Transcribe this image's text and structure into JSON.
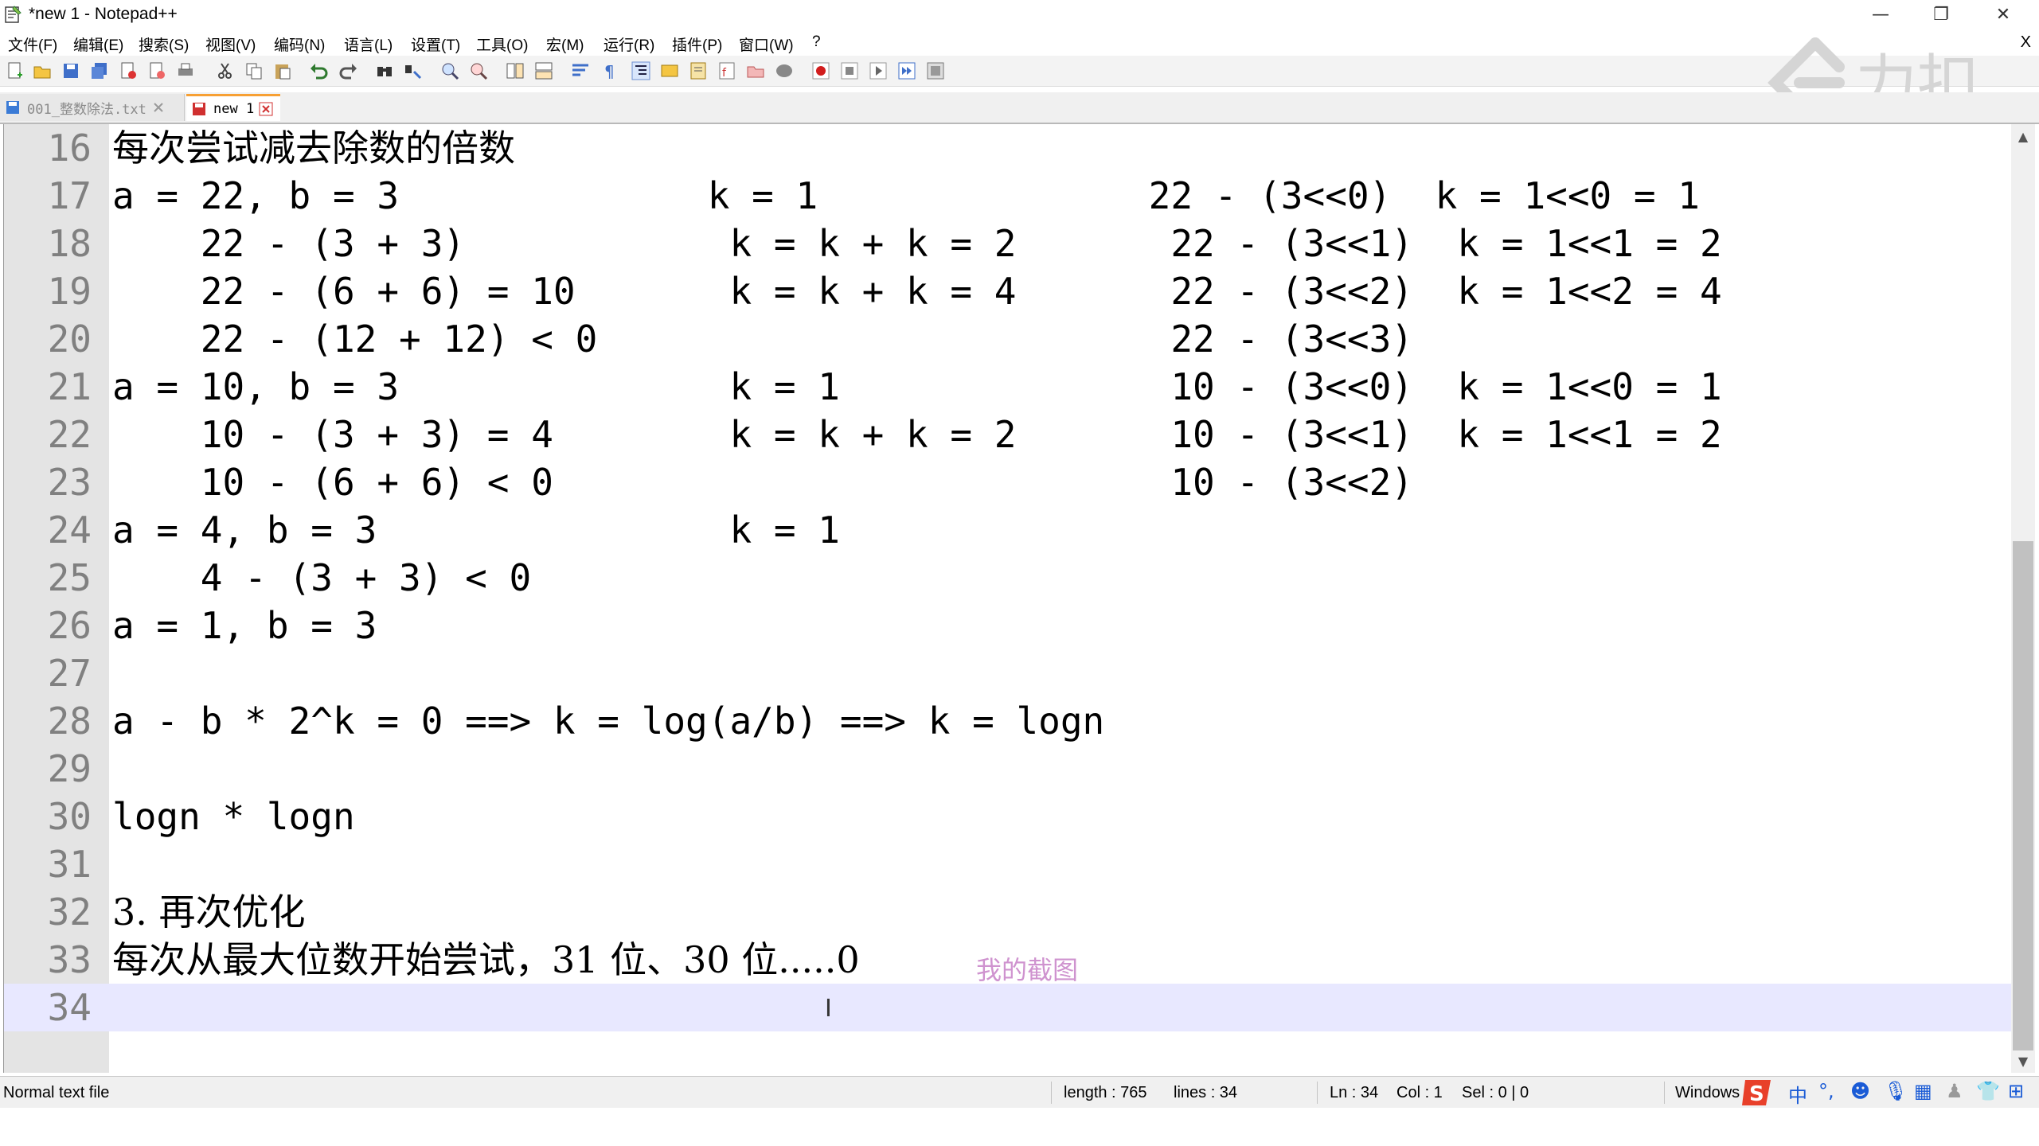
{
  "window": {
    "title": "*new 1 - Notepad++",
    "minimize": "—",
    "restore": "❐",
    "close": "✕"
  },
  "menu": {
    "items": [
      "文件(F)",
      "编辑(E)",
      "搜索(S)",
      "视图(V)",
      "编码(N)",
      "语言(L)",
      "设置(T)",
      "工具(O)",
      "宏(M)",
      "运行(R)",
      "插件(P)",
      "窗口(W)",
      "?"
    ],
    "close_doc": "X"
  },
  "toolbar": {
    "icons": [
      "new-file-icon",
      "open-file-icon",
      "save-icon",
      "save-all-icon",
      "close-icon",
      "close-all-icon",
      "print-icon",
      "cut-icon",
      "copy-icon",
      "paste-icon",
      "undo-icon",
      "redo-icon",
      "find-icon",
      "replace-icon",
      "zoom-in-icon",
      "zoom-out-icon",
      "sync-v-icon",
      "sync-h-icon",
      "word-wrap-icon",
      "show-all-chars-icon",
      "indent-guide-icon",
      "udl-icon",
      "doc-map-icon",
      "function-list-icon",
      "folder-workspace-icon",
      "monitor-icon",
      "record-macro-icon",
      "stop-record-icon",
      "play-macro-icon",
      "run-macro-multiple-icon",
      "save-macro-icon"
    ]
  },
  "watermark": {
    "text": "力扣"
  },
  "tabs": [
    {
      "label": "001_整数除法.txt",
      "active": false,
      "color": "#3b7bd6"
    },
    {
      "label": "new 1",
      "active": true,
      "color": "#d03030"
    }
  ],
  "editor": {
    "lines": [
      {
        "num": "16",
        "text": "每次尝试减去除数的倍数"
      },
      {
        "num": "17",
        "text": "a = 22, b = 3              k = 1               22 - (3<<0)  k = 1<<0 = 1"
      },
      {
        "num": "18",
        "text": "    22 - (3 + 3)            k = k + k = 2       22 - (3<<1)  k = 1<<1 = 2"
      },
      {
        "num": "19",
        "text": "    22 - (6 + 6) = 10       k = k + k = 4       22 - (3<<2)  k = 1<<2 = 4"
      },
      {
        "num": "20",
        "text": "    22 - (12 + 12) < 0                          22 - (3<<3)"
      },
      {
        "num": "21",
        "text": "a = 10, b = 3               k = 1               10 - (3<<0)  k = 1<<0 = 1"
      },
      {
        "num": "22",
        "text": "    10 - (3 + 3) = 4        k = k + k = 2       10 - (3<<1)  k = 1<<1 = 2"
      },
      {
        "num": "23",
        "text": "    10 - (6 + 6) < 0                            10 - (3<<2)"
      },
      {
        "num": "24",
        "text": "a = 4, b = 3                k = 1"
      },
      {
        "num": "25",
        "text": "    4 - (3 + 3) < 0"
      },
      {
        "num": "26",
        "text": "a = 1, b = 3"
      },
      {
        "num": "27",
        "text": ""
      },
      {
        "num": "28",
        "text": "a - b * 2^k = 0 ==> k = log(a/b) ==> k = logn"
      },
      {
        "num": "29",
        "text": ""
      },
      {
        "num": "30",
        "text": "logn * logn"
      },
      {
        "num": "31",
        "text": ""
      },
      {
        "num": "32",
        "text": "3. 再次优化"
      },
      {
        "num": "33",
        "text": "每次从最大位数开始尝试，31 位、30 位.....0"
      },
      {
        "num": "34",
        "text": ""
      }
    ],
    "ime_overlay": "我的截图",
    "current_line": "34"
  },
  "status": {
    "file_type": "Normal text file",
    "length": "length : 765",
    "lines": "lines : 34",
    "ln": "Ln : 34",
    "col": "Col : 1",
    "sel": "Sel : 0 | 0",
    "eol": "Windows",
    "ime_mode": "中",
    "ime_punct": "°,"
  },
  "colors": {
    "gutter": "#e4e4e4",
    "current_line": "#e8e8ff",
    "active_tab_accent": "#f7a034",
    "sogou": "#e8402a"
  }
}
